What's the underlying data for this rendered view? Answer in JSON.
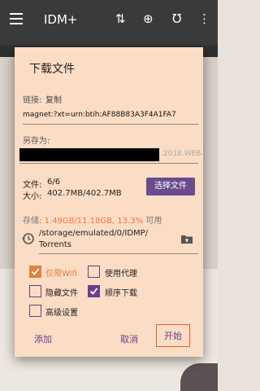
{
  "app": {
    "title": "IDM+"
  },
  "dialog": {
    "title": "下载文件",
    "link_label": "链接:",
    "copy_label": "复制",
    "link_value": "magnet:?xt=urn:btih:AF88B83A3F4A1FA7",
    "save_as_label": "另存为:",
    "filename_tail": ".2018.WEB-",
    "files_label": "文件:",
    "files_value": "6/6",
    "size_label": "大小:",
    "size_value": "402.7MB/402.7MB",
    "choose_files": "选择文件",
    "storage_label": "存储:",
    "storage_used": "1.49GB/11.18GB, 13.3%",
    "storage_suffix": "可用",
    "path_line1": "/storage/emulated/0/IDMP/",
    "path_line2": "Torrents",
    "options": {
      "wifi_only": "仅限Wifi",
      "use_proxy": "使用代理",
      "hide_files": "隐藏文件",
      "sequential": "顺序下载",
      "advanced": "高级设置"
    },
    "actions": {
      "add": "添加",
      "cancel": "取消",
      "start": "开始"
    }
  },
  "colors": {
    "accent": "#6b3f86",
    "highlight": "#e0813f",
    "dialog_bg": "#fbdcc4"
  }
}
